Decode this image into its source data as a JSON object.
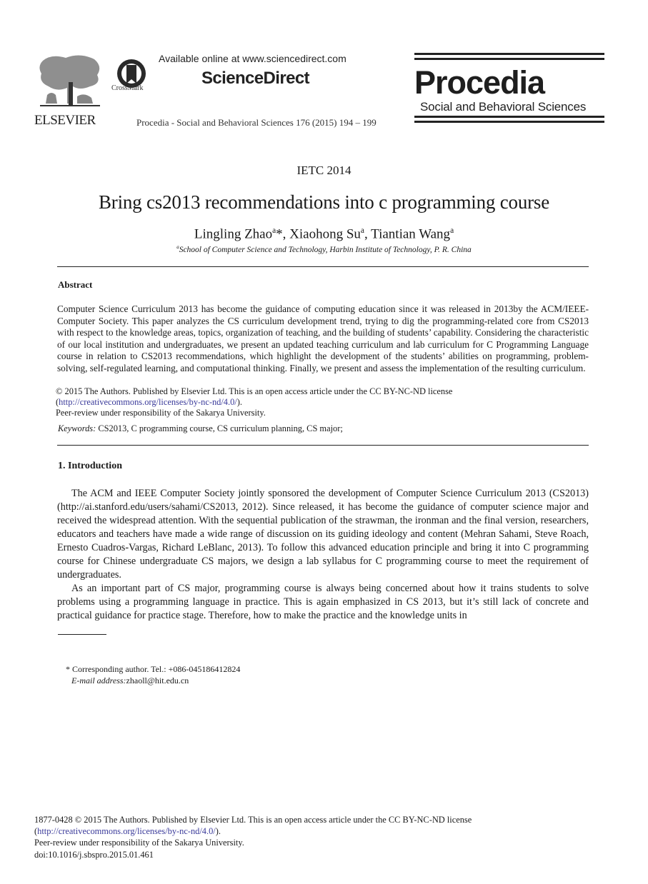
{
  "header": {
    "publisher_logo_label": "ELSEVIER",
    "crossmark_label": "CrossMark",
    "available_online": "Available online at www.sciencedirect.com",
    "platform_name": "ScienceDirect",
    "journal_citation": "Procedia - Social and Behavioral Sciences 176 (2015) 194 – 199",
    "journal_logo_word": "Procedia",
    "journal_logo_subtitle": "Social and Behavioral Sciences"
  },
  "article": {
    "conference": "IETC 2014",
    "title": "Bring cs2013 recommendations into c programming course",
    "authors": [
      {
        "name": "Lingling Zhao",
        "sup": "a",
        "mark": "*",
        "sep": ", "
      },
      {
        "name": "Xiaohong Su",
        "sup": "a",
        "mark": "",
        "sep": ", "
      },
      {
        "name": "Tiantian Wang",
        "sup": "a",
        "mark": "",
        "sep": ""
      }
    ],
    "affiliation_sup": "a",
    "affiliation": "School of Computer Science and Technology, Harbin Institute of Technology, P. R. China"
  },
  "abstract": {
    "heading": "Abstract",
    "text": "Computer Science Curriculum 2013 has become the guidance of computing education since it was released in 2013by the ACM/IEEE-Computer Society. This paper analyzes the CS curriculum development trend, trying to dig the programming-related core from CS2013 with respect to the knowledge areas, topics, organization of teaching, and the building of students’ capability. Considering the characteristic of our local institution and undergraduates, we present an updated teaching curriculum and lab curriculum for C Programming Language course in relation to CS2013 recommendations, which highlight the development of the students’ abilities on programming, problem-solving, self-regulated learning, and computational thinking. Finally, we present and assess the implementation of the resulting curriculum.",
    "copyright": "© 2015 The Authors. Published by Elsevier Ltd. This is an open access article under the CC BY-NC-ND license",
    "license_link": "http://creativecommons.org/licenses/by-nc-nd/4.0/",
    "peer_review": "Peer-review under responsibility of the Sakarya University.",
    "keywords_label": "Keywords:",
    "keywords": "CS2013, C programming course, CS curriculum planning, CS major;"
  },
  "introduction": {
    "heading": "1. Introduction",
    "paragraphs": [
      "The ACM and IEEE Computer Society jointly sponsored the development of Computer Science Curriculum 2013 (CS2013) (http://ai.stanford.edu/users/sahami/CS2013, 2012). Since released, it has become the guidance of computer science major and received the widespread attention. With the sequential publication of the strawman, the ironman and the final version, researchers, educators and teachers have made a wide range of discussion on its guiding ideology and content (Mehran Sahami, Steve Roach, Ernesto Cuadros-Vargas, Richard LeBlanc, 2013). To follow this advanced education principle and bring it into C programming course for Chinese undergraduate CS majors, we design a lab syllabus for C programming course to meet the requirement of undergraduates.",
      "As an important part of CS major, programming course is always being concerned about how it trains students to solve problems using a programming language in practice. This is again emphasized in CS 2013, but it’s still lack of concrete and practical guidance for practice stage. Therefore, how to make the practice and the knowledge units in"
    ]
  },
  "footnote": {
    "marker": "*",
    "corresponding": "Corresponding author. Tel.: +086-045186412824",
    "email_label": "E-mail address:",
    "email": "zhaoll@hit.edu.cn"
  },
  "footer": {
    "issn_copyright": "1877-0428 © 2015 The Authors. Published by Elsevier Ltd. This is an open access article under the CC BY-NC-ND license",
    "license_link": "http://creativecommons.org/licenses/by-nc-nd/4.0/",
    "peer_review": "Peer-review under responsibility of the Sakarya University.",
    "doi": "doi:10.1016/j.sbspro.2015.01.461"
  },
  "colors": {
    "link": "#3a3a9a",
    "text": "#1a1a1a"
  }
}
